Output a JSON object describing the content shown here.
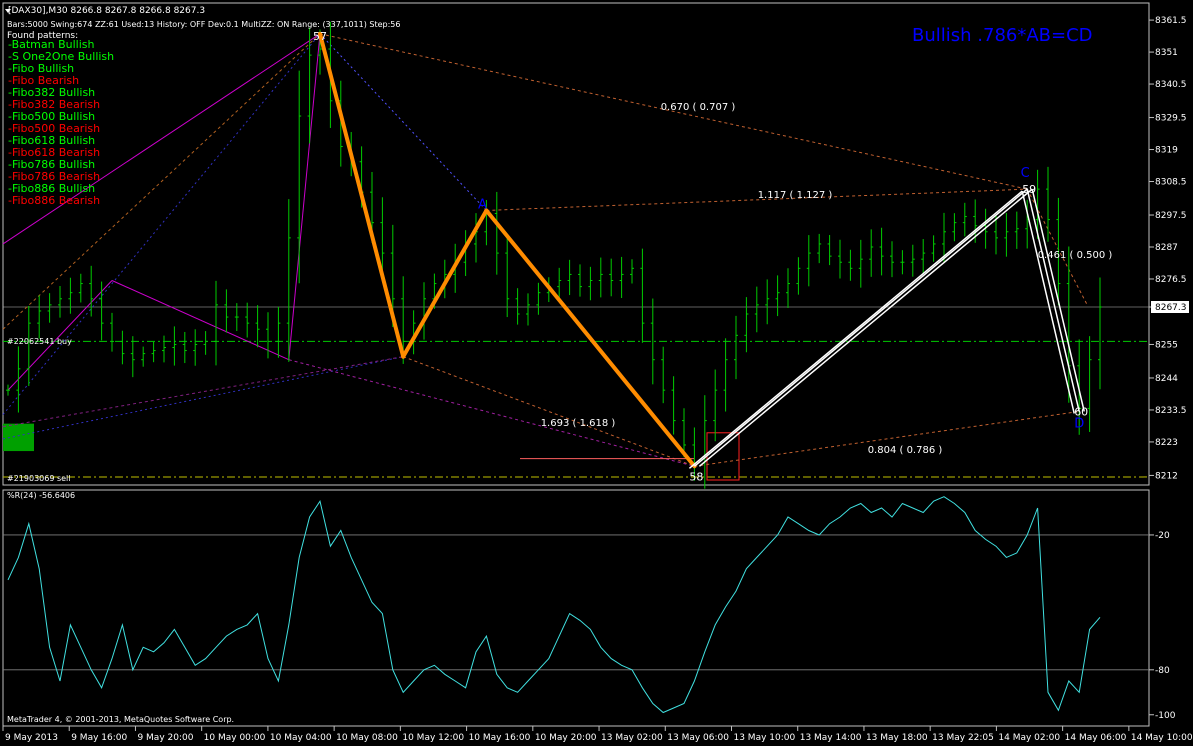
{
  "header": {
    "symbol_line": "[DAX30],M30  8266.8 8267.8 8266.8 8267.3",
    "info_line": "Bars:5000  Swing:674  ZZ:61  Used:13  History: OFF Dev:0.1  MultiZZ: ON  Range: (337,1011)  Step:56"
  },
  "patterns": {
    "title": "Found patterns:",
    "items": [
      {
        "label": "-Batman Bullish",
        "color": "#00ff00"
      },
      {
        "label": "-S One2One Bullish",
        "color": "#00ff00"
      },
      {
        "label": "-Fibo Bullish",
        "color": "#00ff00"
      },
      {
        "label": "-Fibo Bearish",
        "color": "#ff0000"
      },
      {
        "label": "-Fibo382 Bullish",
        "color": "#00ff00"
      },
      {
        "label": "-Fibo382 Bearish",
        "color": "#ff0000"
      },
      {
        "label": "-Fibo500 Bullish",
        "color": "#00ff00"
      },
      {
        "label": "-Fibo500 Bearish",
        "color": "#ff0000"
      },
      {
        "label": "-Fibo618 Bullish",
        "color": "#00ff00"
      },
      {
        "label": "-Fibo618 Bearish",
        "color": "#ff0000"
      },
      {
        "label": "-Fibo786 Bullish",
        "color": "#00ff00"
      },
      {
        "label": "-Fibo786 Bearish",
        "color": "#ff0000"
      },
      {
        "label": "-Fibo886 Bullish",
        "color": "#00ff00"
      },
      {
        "label": "-Fibo886 Bearish",
        "color": "#ff0000"
      }
    ]
  },
  "signal_title": "Bullish .786*AB=CD",
  "copyright": "MetaTrader 4, © 2001-2013, MetaQuotes Software Corp.",
  "orders": {
    "buy": "#22062541 buy",
    "sell": "#21903069 sell"
  },
  "colors": {
    "background": "#000000",
    "bars": "#00cc00",
    "grid": "#c0c0c0",
    "abcd": "#ff8c00",
    "zigzag": "#cc00cc",
    "cd_lines": "#ffffff",
    "wpr": "#40e0e0",
    "signal": "#0000ff"
  },
  "chart_data": [
    {
      "type": "ohlc",
      "title": "[DAX30],M30",
      "y_ticks": [
        8361.5,
        8351.0,
        8340.5,
        8329.5,
        8319.0,
        8308.5,
        8297.5,
        8287.0,
        8276.5,
        8267.3,
        8255.0,
        8244.0,
        8233.5,
        8223.0,
        8212.0
      ],
      "current_price": 8267.3,
      "ylim": [
        8210.5,
        8363.5
      ],
      "x_ticks": [
        "9 May 2013",
        "9 May 16:00",
        "9 May 20:00",
        "10 May 00:00",
        "10 May 04:00",
        "10 May 08:00",
        "10 May 12:00",
        "10 May 16:00",
        "10 May 20:00",
        "13 May 02:00",
        "13 May 06:00",
        "13 May 10:00",
        "13 May 14:00",
        "13 May 18:00",
        "13 May 22:05",
        "14 May 02:00",
        "14 May 06:00",
        "14 May 10:00"
      ],
      "close_path": [
        8240,
        8247,
        8262,
        8266,
        8268,
        8270,
        8272,
        8275,
        8270,
        8262,
        8256,
        8252,
        8250,
        8252,
        8253,
        8254,
        8255,
        8253,
        8255,
        8256,
        8268,
        8264,
        8264,
        8262,
        8260,
        8256,
        8262,
        8290,
        8330,
        8350,
        8352,
        8335,
        8320,
        8315,
        8305,
        8295,
        8285,
        8270,
        8256,
        8262,
        8270,
        8275,
        8278,
        8282,
        8288,
        8292,
        8298,
        8285,
        8270,
        8265,
        8268,
        8272,
        8274,
        8276,
        8278,
        8274,
        8276,
        8278,
        8276,
        8278,
        8280,
        8262,
        8250,
        8240,
        8230,
        8222,
        8216,
        8230,
        8240,
        8250,
        8258,
        8265,
        8268,
        8270,
        8272,
        8275,
        8280,
        8285,
        8288,
        8284,
        8282,
        8280,
        8283,
        8287,
        8284,
        8282,
        8282,
        8283,
        8285,
        8288,
        8292,
        8295,
        8297,
        8294,
        8292,
        8290,
        8292,
        8293,
        8296,
        8306,
        8296,
        8275,
        8248,
        8234,
        8250,
        8267.3
      ],
      "markers": [
        {
          "label": "57",
          "price": 8357
        },
        {
          "label": "A",
          "price": 8299
        },
        {
          "label": "58",
          "price": 8215
        },
        {
          "label": "C",
          "price": 8307
        },
        {
          "label": "59",
          "price": 8306
        },
        {
          "label": "60",
          "price": 8233
        },
        {
          "label": "D",
          "price": 8230
        }
      ],
      "annotations": [
        "0.670 ( 0.707 )",
        "1.117 ( 1.127 )",
        "0.461 ( 0.500 )",
        "1.693 ( 1.618 )",
        "0.804 ( 0.786 )"
      ]
    },
    {
      "type": "line",
      "title": "%R(24) -56.6406",
      "series": [
        {
          "name": "%R(24)",
          "values": [
            -40,
            -30,
            -15,
            -35,
            -70,
            -85,
            -60,
            -70,
            -80,
            -88,
            -75,
            -60,
            -80,
            -70,
            -72,
            -68,
            -62,
            -70,
            -78,
            -75,
            -70,
            -65,
            -62,
            -60,
            -55,
            -75,
            -85,
            -60,
            -30,
            -12,
            -5,
            -25,
            -18,
            -30,
            -40,
            -50,
            -55,
            -80,
            -90,
            -85,
            -80,
            -78,
            -82,
            -85,
            -88,
            -72,
            -65,
            -82,
            -88,
            -90,
            -85,
            -80,
            -75,
            -65,
            -55,
            -58,
            -62,
            -70,
            -75,
            -78,
            -80,
            -88,
            -95,
            -99,
            -97,
            -95,
            -85,
            -72,
            -60,
            -52,
            -45,
            -35,
            -30,
            -25,
            -20,
            -12,
            -15,
            -18,
            -20,
            -15,
            -12,
            -8,
            -6,
            -10,
            -8,
            -12,
            -6,
            -8,
            -10,
            -5,
            -3,
            -6,
            -10,
            -18,
            -22,
            -25,
            -30,
            -28,
            -20,
            -8,
            -90,
            -98,
            -85,
            -90,
            -62,
            -56.64
          ]
        }
      ],
      "y_ticks": [
        -20,
        -80,
        -100
      ],
      "ylim": [
        -105,
        0
      ]
    }
  ]
}
